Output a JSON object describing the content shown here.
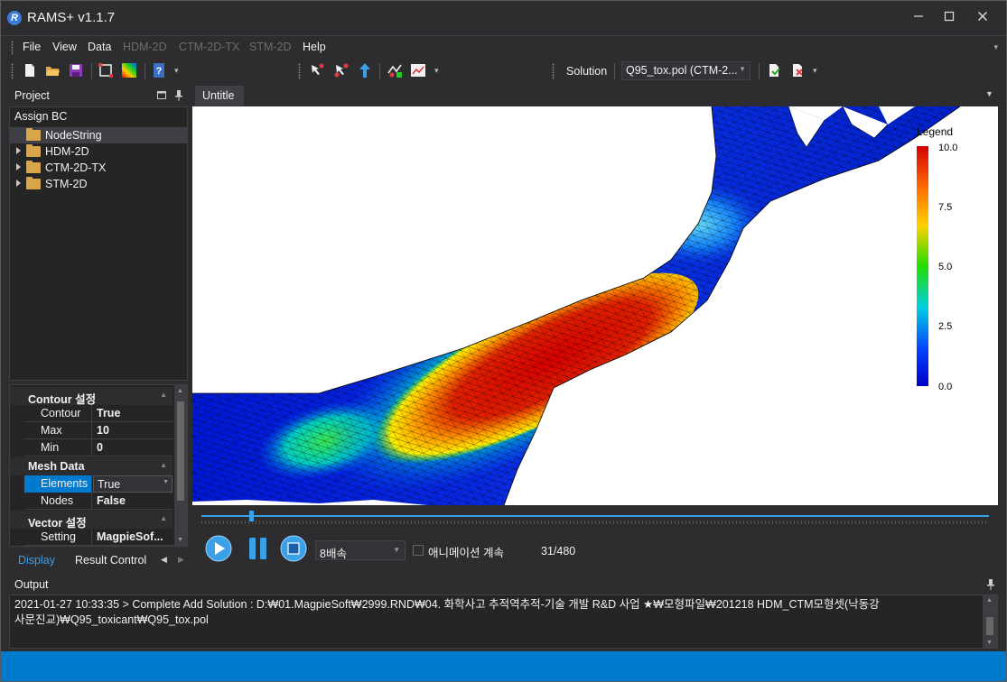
{
  "app": {
    "title": "RAMS+ v1.1.7",
    "icon_letter": "R",
    "window_controls": [
      "minimize-icon",
      "maximize-icon",
      "close-icon"
    ]
  },
  "menu": {
    "items": [
      {
        "label": "File",
        "enabled": true
      },
      {
        "label": "View",
        "enabled": true
      },
      {
        "label": "Data",
        "enabled": true
      },
      {
        "label": "HDM-2D",
        "enabled": false
      },
      {
        "label": "CTM-2D-TX",
        "enabled": false
      },
      {
        "label": "STM-2D",
        "enabled": false
      },
      {
        "label": "Help",
        "enabled": true
      }
    ]
  },
  "toolbar": {
    "solution_label": "Solution",
    "solution_value": "Q95_tox.pol (CTM-2...",
    "icons": [
      "new-file-icon",
      "open-folder-icon",
      "save-icon",
      "select-box-icon",
      "contour-color-icon",
      "help-book-icon",
      "pointer-node-icon",
      "pointer-edit-icon",
      "pointer-arrow-icon",
      "upstream-icon",
      "graph-icon",
      "export-solution-icon",
      "remove-solution-icon"
    ]
  },
  "project": {
    "header": "Project",
    "section": "Assign BC",
    "tree": [
      {
        "label": "NodeString",
        "expandable": false,
        "selected": true
      },
      {
        "label": "HDM-2D",
        "expandable": true,
        "selected": false
      },
      {
        "label": "CTM-2D-TX",
        "expandable": true,
        "selected": false
      },
      {
        "label": "STM-2D",
        "expandable": true,
        "selected": false
      }
    ]
  },
  "properties": {
    "contour": {
      "title": "Contour 설정",
      "rows": [
        {
          "name": "Contour",
          "value": "True"
        },
        {
          "name": "Max",
          "value": "10"
        },
        {
          "name": "Min",
          "value": "0"
        }
      ]
    },
    "mesh": {
      "title": "Mesh Data",
      "rows": [
        {
          "name": "Elements",
          "value": "True",
          "selected": true
        },
        {
          "name": "Nodes",
          "value": "False"
        }
      ]
    },
    "vector": {
      "title": "Vector 설정",
      "rows": [
        {
          "name": "Setting",
          "value": "MagpieSof..."
        }
      ]
    }
  },
  "bottom_tabs": [
    {
      "label": "Display",
      "active": true
    },
    {
      "label": "Result Control",
      "active": false
    }
  ],
  "document": {
    "tab": "Untitle"
  },
  "legend": {
    "title": "Legend",
    "ticks": [
      "10.0",
      "7.5",
      "5.0",
      "2.5",
      "0.0"
    ],
    "max": 10.0,
    "min": 0.0,
    "colors": [
      "#d40000",
      "#ff6a00",
      "#ffd000",
      "#22dd00",
      "#00d0e0",
      "#0040ff",
      "#0000c8"
    ]
  },
  "animation": {
    "speed": "8배속",
    "continuous_label": "애니메이션 계속",
    "continuous_checked": false,
    "frame": "31/480",
    "progress": 0.0625,
    "accent": "#3aa0e8"
  },
  "output": {
    "header": "Output",
    "lines": [
      "2021-01-27 10:33:35 > Complete Add Solution : D:₩01.MagpieSoft₩2999.RND₩04. 화학사고 추적역추적-기술 개발 R&D 사업 ★₩모형파일₩201218 HDM_CTM모형셋(낙동강",
      "사문진교)₩Q95_toxicant₩Q95_tox.pol"
    ]
  },
  "colors": {
    "background": "#2d2d30",
    "panel": "#252526",
    "status_bar": "#007acc",
    "accent": "#007acc"
  }
}
